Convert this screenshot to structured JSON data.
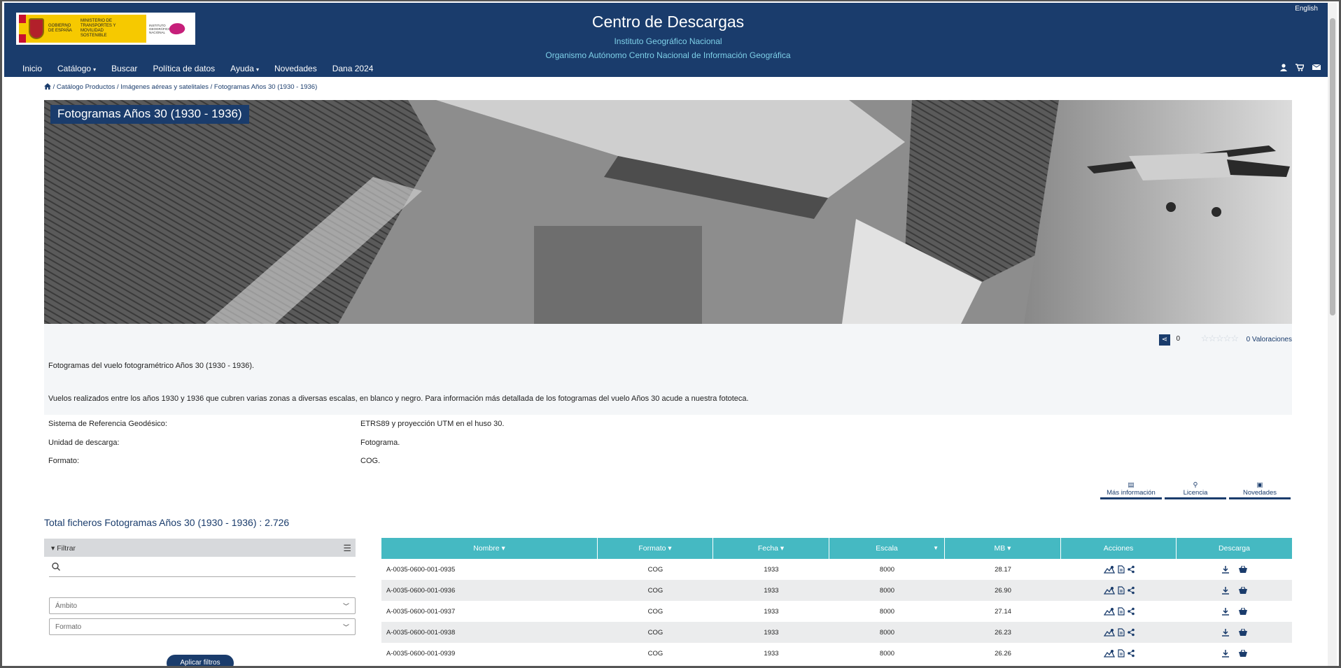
{
  "header": {
    "title": "Centro de Descargas",
    "subtitle1": "Instituto Geográfico Nacional",
    "subtitle2": "Organismo Autónomo Centro Nacional de Información Geográfica",
    "language": "English",
    "logo_gob": "GOBIERNO DE ESPAÑA",
    "logo_min": "MINISTERIO DE TRANSPORTES Y MOVILIDAD SOSTENIBLE",
    "logo_ign": "INSTITUTO GEOGRÁFICO NACIONAL"
  },
  "nav": {
    "items": [
      "Inicio",
      "Catálogo",
      "Buscar",
      "Política de datos",
      "Ayuda",
      "Novedades",
      "Dana 2024"
    ],
    "caret": "▾"
  },
  "icons": {
    "home": "home-icon",
    "user": "user-icon",
    "cart": "cart-icon",
    "mail": "mail-icon",
    "share": "share-icon"
  },
  "breadcrumb": {
    "items": [
      "Catálogo Productos",
      "Imágenes aéreas y satelitales",
      "Fotogramas Años 30 (1930 - 1936)"
    ],
    "sep": "/"
  },
  "banner": {
    "title": "Fotogramas Años 30 (1930 - 1936)"
  },
  "ratings": {
    "count": "0",
    "stars": "☆☆☆☆☆",
    "label": "0 Valoraciones"
  },
  "description": {
    "line1": "Fotogramas del vuelo fotogramétrico Años 30 (1930 - 1936).",
    "line2": "Vuelos realizados entre los años 1930 y 1936 que cubren varias zonas a diversas escalas, en blanco y negro. Para información más detallada de los fotogramas del vuelo Años 30 acude a nuestra fototeca."
  },
  "properties": [
    {
      "label": "Sistema de Referencia Geodésico:",
      "value": "ETRS89 y proyección UTM en el huso 30."
    },
    {
      "label": "Unidad de descarga:",
      "value": "Fotograma."
    },
    {
      "label": "Formato:",
      "value": "COG."
    }
  ],
  "info_buttons": [
    "Más información",
    "Licencia",
    "Novedades"
  ],
  "total_label": "Total ficheros Fotogramas Años 30 (1930 - 1936) : 2.726",
  "filter": {
    "title": "Filtrar",
    "search_placeholder": "",
    "ambito": "Ámbito",
    "formato": "Formato",
    "apply": "Aplicar filtros"
  },
  "table": {
    "headers": [
      "Nombre ▾",
      "Formato ▾",
      "Fecha ▾",
      "Escala",
      "MB ▾",
      "Acciones",
      "Descarga"
    ],
    "rows": [
      {
        "nombre": "A-0035-0600-001-0935",
        "formato": "COG",
        "fecha": "1933",
        "escala": "8000",
        "mb": "28.17"
      },
      {
        "nombre": "A-0035-0600-001-0936",
        "formato": "COG",
        "fecha": "1933",
        "escala": "8000",
        "mb": "26.90"
      },
      {
        "nombre": "A-0035-0600-001-0937",
        "formato": "COG",
        "fecha": "1933",
        "escala": "8000",
        "mb": "27.14"
      },
      {
        "nombre": "A-0035-0600-001-0938",
        "formato": "COG",
        "fecha": "1933",
        "escala": "8000",
        "mb": "26.23"
      },
      {
        "nombre": "A-0035-0600-001-0939",
        "formato": "COG",
        "fecha": "1933",
        "escala": "8000",
        "mb": "26.26"
      }
    ]
  },
  "colors": {
    "navy": "#1a3c6c",
    "teal": "#45b9c2",
    "cyan_text": "#7ed0e8"
  }
}
